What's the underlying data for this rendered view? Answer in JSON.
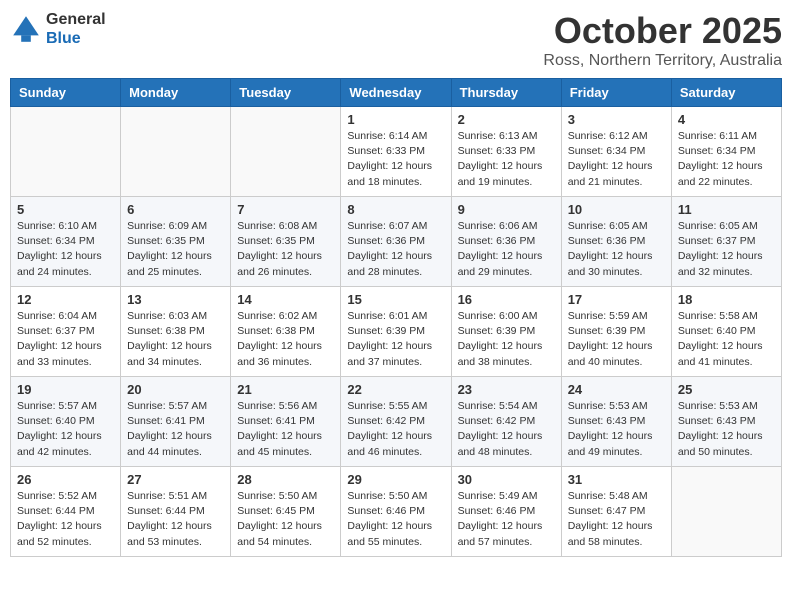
{
  "header": {
    "logo_general": "General",
    "logo_blue": "Blue",
    "month": "October 2025",
    "location": "Ross, Northern Territory, Australia"
  },
  "weekdays": [
    "Sunday",
    "Monday",
    "Tuesday",
    "Wednesday",
    "Thursday",
    "Friday",
    "Saturday"
  ],
  "weeks": [
    [
      {
        "day": "",
        "info": ""
      },
      {
        "day": "",
        "info": ""
      },
      {
        "day": "",
        "info": ""
      },
      {
        "day": "1",
        "info": "Sunrise: 6:14 AM\nSunset: 6:33 PM\nDaylight: 12 hours\nand 18 minutes."
      },
      {
        "day": "2",
        "info": "Sunrise: 6:13 AM\nSunset: 6:33 PM\nDaylight: 12 hours\nand 19 minutes."
      },
      {
        "day": "3",
        "info": "Sunrise: 6:12 AM\nSunset: 6:34 PM\nDaylight: 12 hours\nand 21 minutes."
      },
      {
        "day": "4",
        "info": "Sunrise: 6:11 AM\nSunset: 6:34 PM\nDaylight: 12 hours\nand 22 minutes."
      }
    ],
    [
      {
        "day": "5",
        "info": "Sunrise: 6:10 AM\nSunset: 6:34 PM\nDaylight: 12 hours\nand 24 minutes."
      },
      {
        "day": "6",
        "info": "Sunrise: 6:09 AM\nSunset: 6:35 PM\nDaylight: 12 hours\nand 25 minutes."
      },
      {
        "day": "7",
        "info": "Sunrise: 6:08 AM\nSunset: 6:35 PM\nDaylight: 12 hours\nand 26 minutes."
      },
      {
        "day": "8",
        "info": "Sunrise: 6:07 AM\nSunset: 6:36 PM\nDaylight: 12 hours\nand 28 minutes."
      },
      {
        "day": "9",
        "info": "Sunrise: 6:06 AM\nSunset: 6:36 PM\nDaylight: 12 hours\nand 29 minutes."
      },
      {
        "day": "10",
        "info": "Sunrise: 6:05 AM\nSunset: 6:36 PM\nDaylight: 12 hours\nand 30 minutes."
      },
      {
        "day": "11",
        "info": "Sunrise: 6:05 AM\nSunset: 6:37 PM\nDaylight: 12 hours\nand 32 minutes."
      }
    ],
    [
      {
        "day": "12",
        "info": "Sunrise: 6:04 AM\nSunset: 6:37 PM\nDaylight: 12 hours\nand 33 minutes."
      },
      {
        "day": "13",
        "info": "Sunrise: 6:03 AM\nSunset: 6:38 PM\nDaylight: 12 hours\nand 34 minutes."
      },
      {
        "day": "14",
        "info": "Sunrise: 6:02 AM\nSunset: 6:38 PM\nDaylight: 12 hours\nand 36 minutes."
      },
      {
        "day": "15",
        "info": "Sunrise: 6:01 AM\nSunset: 6:39 PM\nDaylight: 12 hours\nand 37 minutes."
      },
      {
        "day": "16",
        "info": "Sunrise: 6:00 AM\nSunset: 6:39 PM\nDaylight: 12 hours\nand 38 minutes."
      },
      {
        "day": "17",
        "info": "Sunrise: 5:59 AM\nSunset: 6:39 PM\nDaylight: 12 hours\nand 40 minutes."
      },
      {
        "day": "18",
        "info": "Sunrise: 5:58 AM\nSunset: 6:40 PM\nDaylight: 12 hours\nand 41 minutes."
      }
    ],
    [
      {
        "day": "19",
        "info": "Sunrise: 5:57 AM\nSunset: 6:40 PM\nDaylight: 12 hours\nand 42 minutes."
      },
      {
        "day": "20",
        "info": "Sunrise: 5:57 AM\nSunset: 6:41 PM\nDaylight: 12 hours\nand 44 minutes."
      },
      {
        "day": "21",
        "info": "Sunrise: 5:56 AM\nSunset: 6:41 PM\nDaylight: 12 hours\nand 45 minutes."
      },
      {
        "day": "22",
        "info": "Sunrise: 5:55 AM\nSunset: 6:42 PM\nDaylight: 12 hours\nand 46 minutes."
      },
      {
        "day": "23",
        "info": "Sunrise: 5:54 AM\nSunset: 6:42 PM\nDaylight: 12 hours\nand 48 minutes."
      },
      {
        "day": "24",
        "info": "Sunrise: 5:53 AM\nSunset: 6:43 PM\nDaylight: 12 hours\nand 49 minutes."
      },
      {
        "day": "25",
        "info": "Sunrise: 5:53 AM\nSunset: 6:43 PM\nDaylight: 12 hours\nand 50 minutes."
      }
    ],
    [
      {
        "day": "26",
        "info": "Sunrise: 5:52 AM\nSunset: 6:44 PM\nDaylight: 12 hours\nand 52 minutes."
      },
      {
        "day": "27",
        "info": "Sunrise: 5:51 AM\nSunset: 6:44 PM\nDaylight: 12 hours\nand 53 minutes."
      },
      {
        "day": "28",
        "info": "Sunrise: 5:50 AM\nSunset: 6:45 PM\nDaylight: 12 hours\nand 54 minutes."
      },
      {
        "day": "29",
        "info": "Sunrise: 5:50 AM\nSunset: 6:46 PM\nDaylight: 12 hours\nand 55 minutes."
      },
      {
        "day": "30",
        "info": "Sunrise: 5:49 AM\nSunset: 6:46 PM\nDaylight: 12 hours\nand 57 minutes."
      },
      {
        "day": "31",
        "info": "Sunrise: 5:48 AM\nSunset: 6:47 PM\nDaylight: 12 hours\nand 58 minutes."
      },
      {
        "day": "",
        "info": ""
      }
    ]
  ]
}
